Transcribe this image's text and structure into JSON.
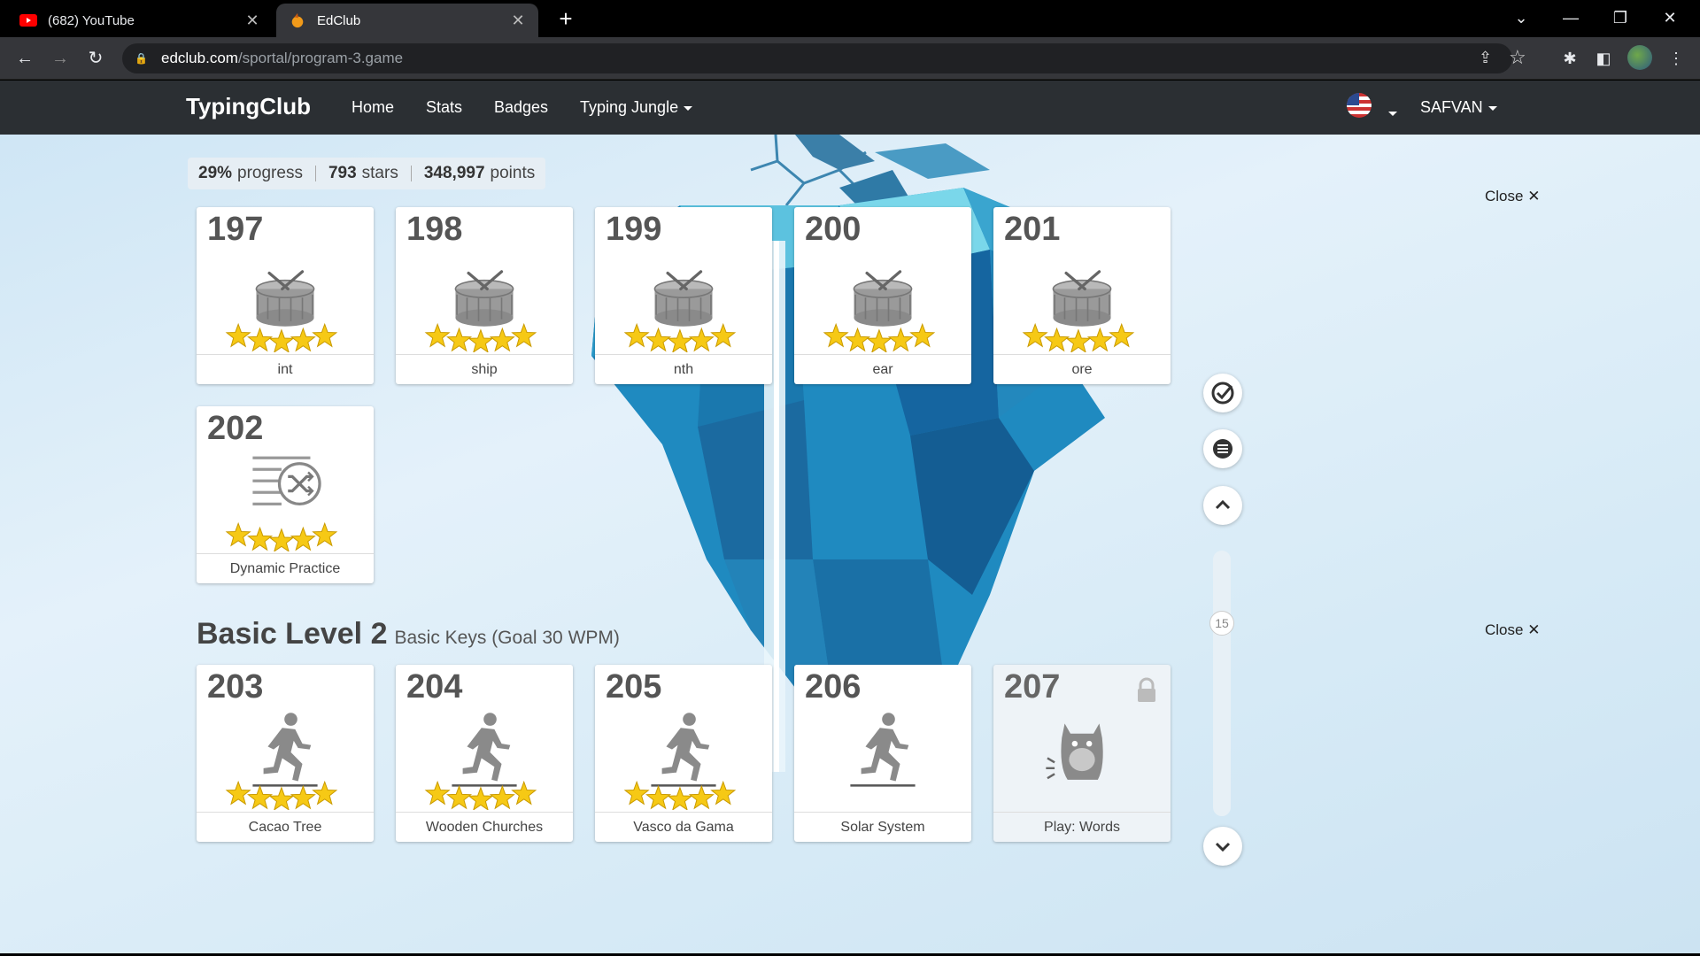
{
  "browser": {
    "tabs": [
      {
        "title": "(682) YouTube",
        "active": false
      },
      {
        "title": "EdClub",
        "active": true
      }
    ],
    "url_host": "edclub.com",
    "url_path": "/sportal/program-3.game"
  },
  "site": {
    "logo": "TypingClub",
    "nav": [
      "Home",
      "Stats",
      "Badges",
      "Typing Jungle"
    ],
    "user": "SAFVAN"
  },
  "stats": {
    "progress_value": "29%",
    "progress_label": "progress",
    "stars_value": "793",
    "stars_label": "stars",
    "points_value": "348,997",
    "points_label": "points"
  },
  "close_label": "Close",
  "section": {
    "title": "Basic Level 2",
    "subtitle": "Basic Keys (Goal 30 WPM)"
  },
  "slider_value": "15",
  "lessons_row1": [
    {
      "num": "197",
      "label": "int",
      "icon": "drum-icon",
      "stars": 5
    },
    {
      "num": "198",
      "label": "ship",
      "icon": "drum-icon",
      "stars": 5
    },
    {
      "num": "199",
      "label": "nth",
      "icon": "drum-icon",
      "stars": 5
    },
    {
      "num": "200",
      "label": "ear",
      "icon": "drum-icon",
      "stars": 5
    },
    {
      "num": "201",
      "label": "ore",
      "icon": "drum-icon",
      "stars": 5
    }
  ],
  "lessons_row2": [
    {
      "num": "202",
      "label": "Dynamic Practice",
      "icon": "shuffle-icon",
      "stars": 5
    }
  ],
  "lessons_row3": [
    {
      "num": "203",
      "label": "Cacao Tree",
      "icon": "runner-icon",
      "stars": 5
    },
    {
      "num": "204",
      "label": "Wooden Churches",
      "icon": "runner-icon",
      "stars": 5
    },
    {
      "num": "205",
      "label": "Vasco da Gama",
      "icon": "runner-icon",
      "stars": 5
    },
    {
      "num": "206",
      "label": "Solar System",
      "icon": "runner-icon",
      "stars": 0
    },
    {
      "num": "207",
      "label": "Play: Words",
      "icon": "monster-icon",
      "stars": 0,
      "locked": true
    }
  ],
  "colors": {
    "nav_bg": "#2b2f33",
    "star": "#f6c915",
    "accent": "#1d8bc0"
  }
}
